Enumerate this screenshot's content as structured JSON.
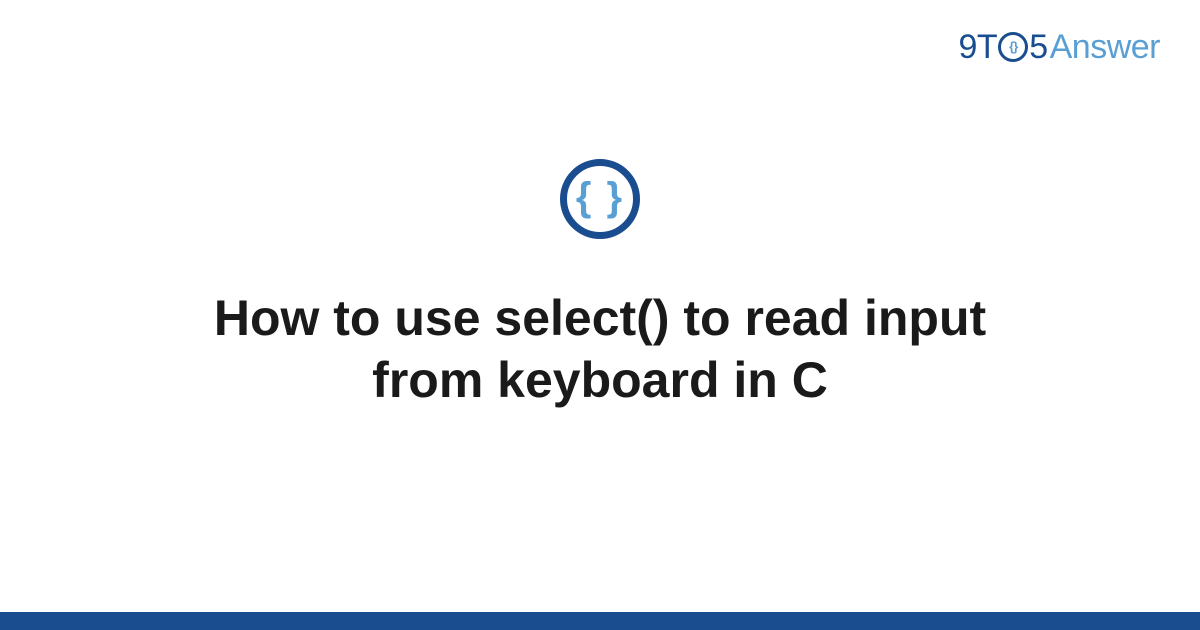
{
  "logo": {
    "part1": "9T",
    "part2": "5",
    "part3": "Answer"
  },
  "category_icon_glyph": "{ }",
  "title": "How to use select() to read input from keyboard in C",
  "colors": {
    "primary": "#1a4d8f",
    "secondary": "#5a9fd4"
  }
}
